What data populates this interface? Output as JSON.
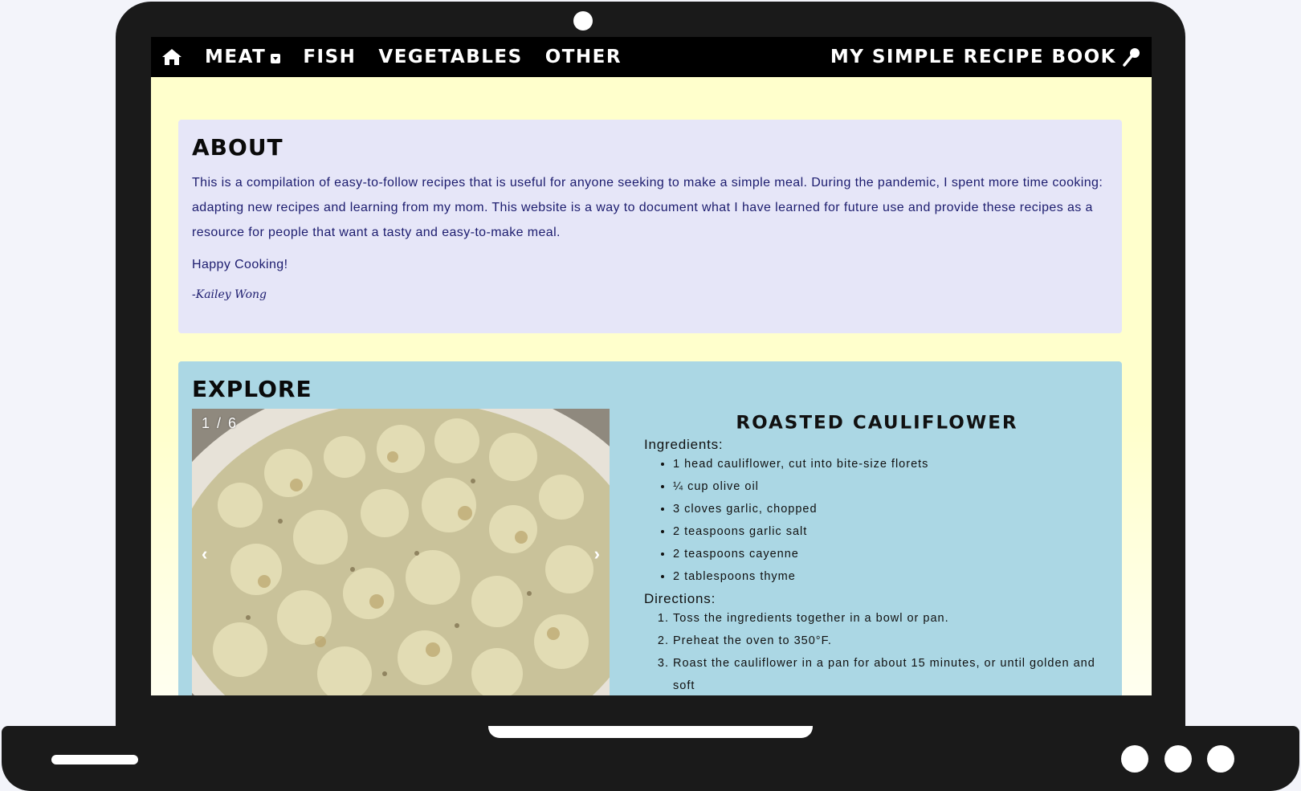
{
  "nav": {
    "home_icon": "home-icon",
    "items": [
      {
        "label": "MEAT"
      },
      {
        "label": "FISH"
      },
      {
        "label": "VEGETABLES"
      },
      {
        "label": "OTHER"
      }
    ],
    "brand": "MY SIMPLE RECIPE BOOK",
    "brand_icon": "spoon-icon"
  },
  "about": {
    "title": "ABOUT",
    "text": "This is a compilation of easy-to-follow recipes that is useful for anyone seeking to make a simple meal. During the pandemic, I spent more time cooking: adapting new recipes and learning from my mom. This website is a way to document what I have learned for future use and provide these recipes as a resource for people that want a tasty and easy-to-make meal.",
    "happy": "Happy Cooking!",
    "signature": "-Kailey Wong"
  },
  "explore": {
    "title": "EXPLORE",
    "slide_counter": "1 / 6",
    "prev": "‹",
    "next": "›",
    "recipe": {
      "title": "ROASTED CAULIFLOWER",
      "ingredients_label": "Ingredients:",
      "ingredients": [
        "1 head cauliflower, cut into bite-size florets",
        "¼ cup olive oil",
        "3 cloves garlic, chopped",
        "2 teaspoons garlic salt",
        "2 teaspoons cayenne",
        "2 tablespoons thyme"
      ],
      "directions_label": "Directions:",
      "directions": [
        "Toss the ingredients together in a bowl or pan.",
        "Preheat the oven to 350°F.",
        "Roast the cauliflower in a pan for about 15 minutes, or until golden and soft"
      ]
    }
  },
  "colors": {
    "navbar": "#000000",
    "about_bg": "#e6e6f8",
    "explore_bg": "#abd7e4",
    "page_bg": "#ffffcc",
    "frame": "#1a1a1a"
  }
}
